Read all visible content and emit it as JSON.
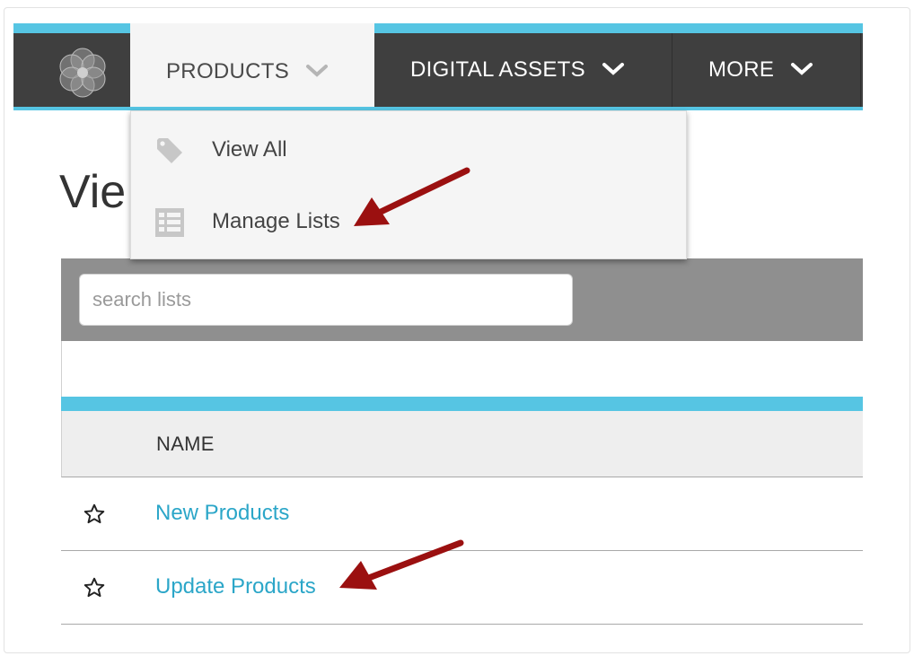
{
  "nav": {
    "products": "PRODUCTS",
    "digital_assets": "DIGITAL ASSETS",
    "more": "MORE",
    "logo_icon": "flower-logo-icon",
    "accent_color": "#56c5e3",
    "bar_color": "#3f3f3f"
  },
  "dropdown": {
    "items": [
      {
        "label": "View All",
        "icon": "tag-icon"
      },
      {
        "label": "Manage Lists",
        "icon": "list-icon"
      }
    ]
  },
  "page": {
    "title_partial": "Vie"
  },
  "search": {
    "placeholder": "search lists",
    "value": ""
  },
  "table": {
    "columns": [
      "NAME"
    ],
    "rows": [
      {
        "name": "New Products",
        "starred": false
      },
      {
        "name": "Update Products",
        "starred": false
      }
    ],
    "link_color": "#2ba6c8"
  },
  "annotations": {
    "arrow_color": "#9b1010"
  }
}
